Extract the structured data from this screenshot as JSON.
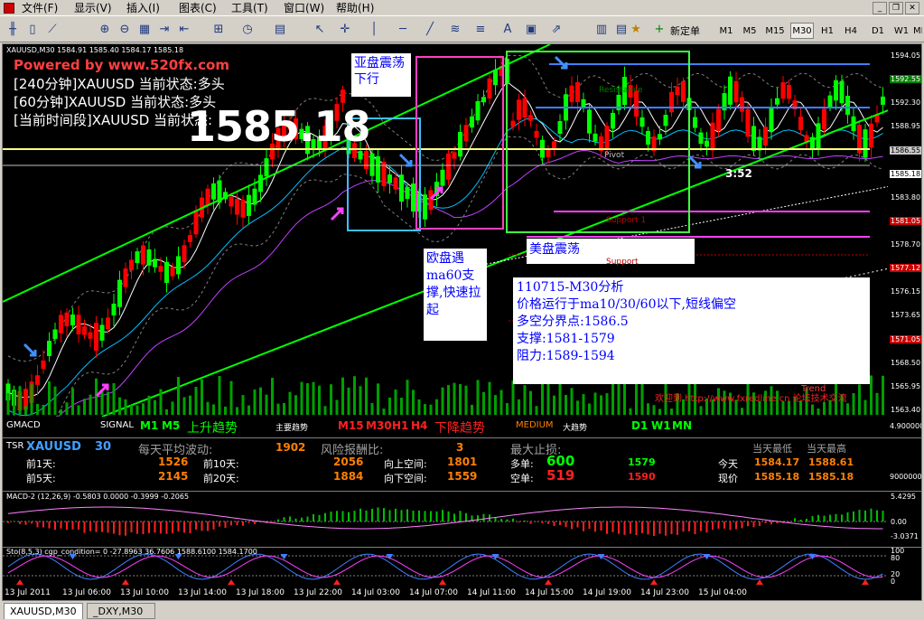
{
  "menu": {
    "items": [
      "文件(F)",
      "显示(V)",
      "插入(I)",
      "图表(C)",
      "工具(T)",
      "窗口(W)",
      "帮助(H)"
    ]
  },
  "toolbar": {
    "new_order_label": "新定单",
    "timeframes": [
      "M1",
      "M5",
      "M15",
      "M30",
      "H1",
      "H4",
      "D1",
      "W1",
      "MN"
    ],
    "active_timeframe": "M30"
  },
  "chart": {
    "header": "XAUUSD,M30  1584.91 1585.40 1584.17 1585.18",
    "powered_by": "Powered by www.520fx.com",
    "status_240": "[240分钟]XAUUSD 当前状态:多头",
    "status_60": "[60分钟]XAUUSD 当前状态:多头",
    "status_now": "[当前时间段]XAUUSD 当前状态:",
    "big_price": "1585.18",
    "countdown": "3:52",
    "box_asia": "亚盘震荡下行",
    "box_europe": "欧盘遇ma60支撑,快速拉起",
    "box_us": "美盘震荡",
    "analysis": {
      "title": "110715-M30分析",
      "line1": "价格运行于ma10/30/60以下,短线偏空",
      "line2": "多空分界点:1586.5",
      "line3": "支撑:1581-1579",
      "line4": "阻力:1589-1594"
    },
    "pivot_label": "Pivot",
    "resistance_label": "Resistance",
    "support_label": "Support 1",
    "support_label2": "Support",
    "trend_label": "Trend",
    "forum": "欢迎到 http://www.fxredline.cn 论坛技术交流",
    "price_labels": [
      {
        "v": "1594.05",
        "bg": ""
      },
      {
        "v": "1592.55",
        "bg": "#008000"
      },
      {
        "v": "1592.30",
        "bg": ""
      },
      {
        "v": "1588.95",
        "bg": ""
      },
      {
        "v": "1586.55",
        "bg": "#c8c8c8"
      },
      {
        "v": "1585.18",
        "bg": "#ffffff"
      },
      {
        "v": "1583.80",
        "bg": ""
      },
      {
        "v": "1581.05",
        "bg": "#c80000"
      },
      {
        "v": "1578.70",
        "bg": ""
      },
      {
        "v": "1577.12",
        "bg": "#c80000"
      },
      {
        "v": "1576.15",
        "bg": ""
      },
      {
        "v": "1573.65",
        "bg": ""
      },
      {
        "v": "1571.05",
        "bg": "#c80000"
      },
      {
        "v": "1568.50",
        "bg": ""
      },
      {
        "v": "1565.95",
        "bg": ""
      },
      {
        "v": "1563.40",
        "bg": ""
      }
    ]
  },
  "strip": {
    "gmacd": "GMACD",
    "signal": "SIGNAL",
    "m1": "M1",
    "m5": "M5",
    "up": "上升趋势",
    "main": "主要趋势",
    "m15": "M15",
    "m30": "M30",
    "h1": "H1",
    "h4": "H4",
    "down": "下降趋势",
    "medium": "MEDIUM",
    "big": "大趋势",
    "d1": "D1",
    "w1": "W1",
    "mn": "MN"
  },
  "info": {
    "tsr": "TSR",
    "symbol": "XAUUSD",
    "period": "30",
    "avg_label": "每天平均波动:",
    "avg_val": "1902",
    "risk_label": "风险报酬比:",
    "risk_val": "3",
    "stop_label": "最大止损:",
    "d1_label": "前1天:",
    "d1_val": "1526",
    "d5_label": "前5天:",
    "d5_val": "2145",
    "d10_label": "前10天:",
    "d10_val": "2056",
    "d20_label": "前20天:",
    "d20_val": "1884",
    "up_label": "向上空间:",
    "up_val": "1801",
    "down_label": "向下空间:",
    "down_val": "1559",
    "long_label": "多单:",
    "long_val": "600",
    "long_price": "1579",
    "short_label": "空单:",
    "short_val": "519",
    "short_price": "1590",
    "low_label": "当天最低",
    "high_label": "当天最高",
    "today_label": "今天",
    "today_low": "1584.17",
    "today_high": "1588.61",
    "now_label": "现价",
    "now_low": "1585.18",
    "now_high": "1585.18",
    "right1": "4.9000000",
    "right2": "9000000"
  },
  "macd": {
    "header": "MACD-2 (12,26,9) -0.5803 0.0000 -0.3999 -0.2065",
    "levels": [
      "5.4295",
      "0.00",
      "-3.0371"
    ]
  },
  "sto": {
    "header": "Sto(8,5,3) cgp_condition= 0 -27.8963 36.7606 1588.6100 1584.1700",
    "levels": [
      "100",
      "80",
      "20",
      "0"
    ]
  },
  "xaxis": {
    "labels": [
      "13 Jul 2011",
      "13 Jul 06:00",
      "13 Jul 10:00",
      "13 Jul 14:00",
      "13 Jul 18:00",
      "13 Jul 22:00",
      "14 Jul 03:00",
      "14 Jul 07:00",
      "14 Jul 11:00",
      "14 Jul 15:00",
      "14 Jul 19:00",
      "14 Jul 23:00",
      "15 Jul 04:00"
    ]
  },
  "tabs": [
    "XAUUSD,M30",
    "_DXY,M30"
  ],
  "colors": {
    "bull": "#00ff00",
    "bear": "#ff0000",
    "channel": "#00ff00",
    "asia_box": "#3fbfff",
    "eu_box": "#ff40c0",
    "us_box": "#40ff40"
  }
}
